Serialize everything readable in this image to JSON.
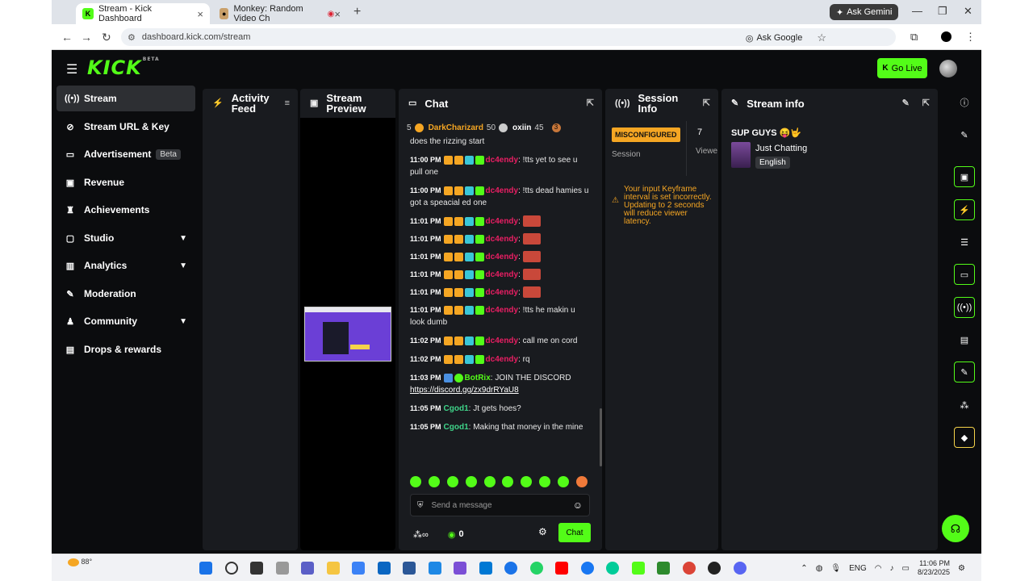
{
  "browser": {
    "tabs": [
      {
        "title": "Stream - Kick Dashboard",
        "favicon": "kick-icon"
      },
      {
        "title": "Monkey: Random Video Ch",
        "favicon": "monkey-icon"
      }
    ],
    "gemini_label": "Ask Gemini",
    "url": "dashboard.kick.com/stream",
    "ask_google": "Ask Google"
  },
  "header": {
    "logo": "KICK",
    "logo_sup": "BETA",
    "go_live": "Go Live"
  },
  "sidebar": {
    "items": [
      {
        "label": "Stream",
        "icon": "broadcast-icon"
      },
      {
        "label": "Stream URL & Key",
        "icon": "link-icon"
      },
      {
        "label": "Advertisement",
        "icon": "ad-icon",
        "badge": "Beta"
      },
      {
        "label": "Revenue",
        "icon": "revenue-icon"
      },
      {
        "label": "Achievements",
        "icon": "trophy-icon"
      },
      {
        "label": "Studio",
        "icon": "studio-icon"
      },
      {
        "label": "Analytics",
        "icon": "analytics-icon"
      },
      {
        "label": "Moderation",
        "icon": "wrench-icon"
      },
      {
        "label": "Community",
        "icon": "community-icon"
      },
      {
        "label": "Drops & rewards",
        "icon": "drops-icon"
      }
    ]
  },
  "panels": {
    "activity": "Activity Feed",
    "preview": "Stream Preview",
    "chat": "Chat",
    "session": "Session Info",
    "streaminfo": "Stream info"
  },
  "chat": {
    "pinned": [
      {
        "name": "5"
      },
      {
        "name": "DarkCharizard",
        "count": "50"
      },
      {
        "name": "oxiin",
        "count": "45"
      },
      {
        "name": "3"
      }
    ],
    "first_line": "does the rizzing start",
    "messages": [
      {
        "time": "11:00 PM",
        "user": "dc4endy",
        "text": "!tts yet to see u pull one"
      },
      {
        "time": "11:00 PM",
        "user": "dc4endy",
        "text": "!tts dead hamies u got a speacial ed one"
      },
      {
        "time": "11:01 PM",
        "user": "dc4endy",
        "text": ""
      },
      {
        "time": "11:01 PM",
        "user": "dc4endy",
        "text": ""
      },
      {
        "time": "11:01 PM",
        "user": "dc4endy",
        "text": ""
      },
      {
        "time": "11:01 PM",
        "user": "dc4endy",
        "text": ""
      },
      {
        "time": "11:01 PM",
        "user": "dc4endy",
        "text": ""
      },
      {
        "time": "11:01 PM",
        "user": "dc4endy",
        "text": "!tts he makin u look dumb"
      },
      {
        "time": "11:02 PM",
        "user": "dc4endy",
        "text": "call me on cord"
      },
      {
        "time": "11:02 PM",
        "user": "dc4endy",
        "text": "rq"
      },
      {
        "time": "11:03 PM",
        "user": "BotRix",
        "text": "JOIN THE DISCORD",
        "link": "https://discord.gg/zx9drRYaU8"
      },
      {
        "time": "11:05 PM",
        "user": "Cgod1",
        "text": "Jt gets hoes?"
      },
      {
        "time": "11:05 PM",
        "user": "Cgod1",
        "text": "Making that money in the mine"
      }
    ],
    "input_placeholder": "Send a message",
    "footer_count": "0",
    "chat_button": "Chat"
  },
  "session": {
    "status": "MISCONFIGURED",
    "session_label": "Session",
    "viewers": "7",
    "viewers_label": "Viewe",
    "warning": "Your input Keyframe interval is set incorrectly. Updating to 2 seconds will reduce viewer latency."
  },
  "streaminfo": {
    "title": "SUP GUYS 😝🤟",
    "category": "Just Chatting",
    "language": "English"
  },
  "taskbar": {
    "weather": "88°",
    "lang": "ENG",
    "time": "11:06 PM",
    "date": "8/23/2025"
  },
  "colors": {
    "kick_green": "#53fc18",
    "warning": "#f5a623",
    "dc4endy": "#e91e63",
    "botrix": "#53fc18",
    "cgod1": "#3fd58a"
  }
}
